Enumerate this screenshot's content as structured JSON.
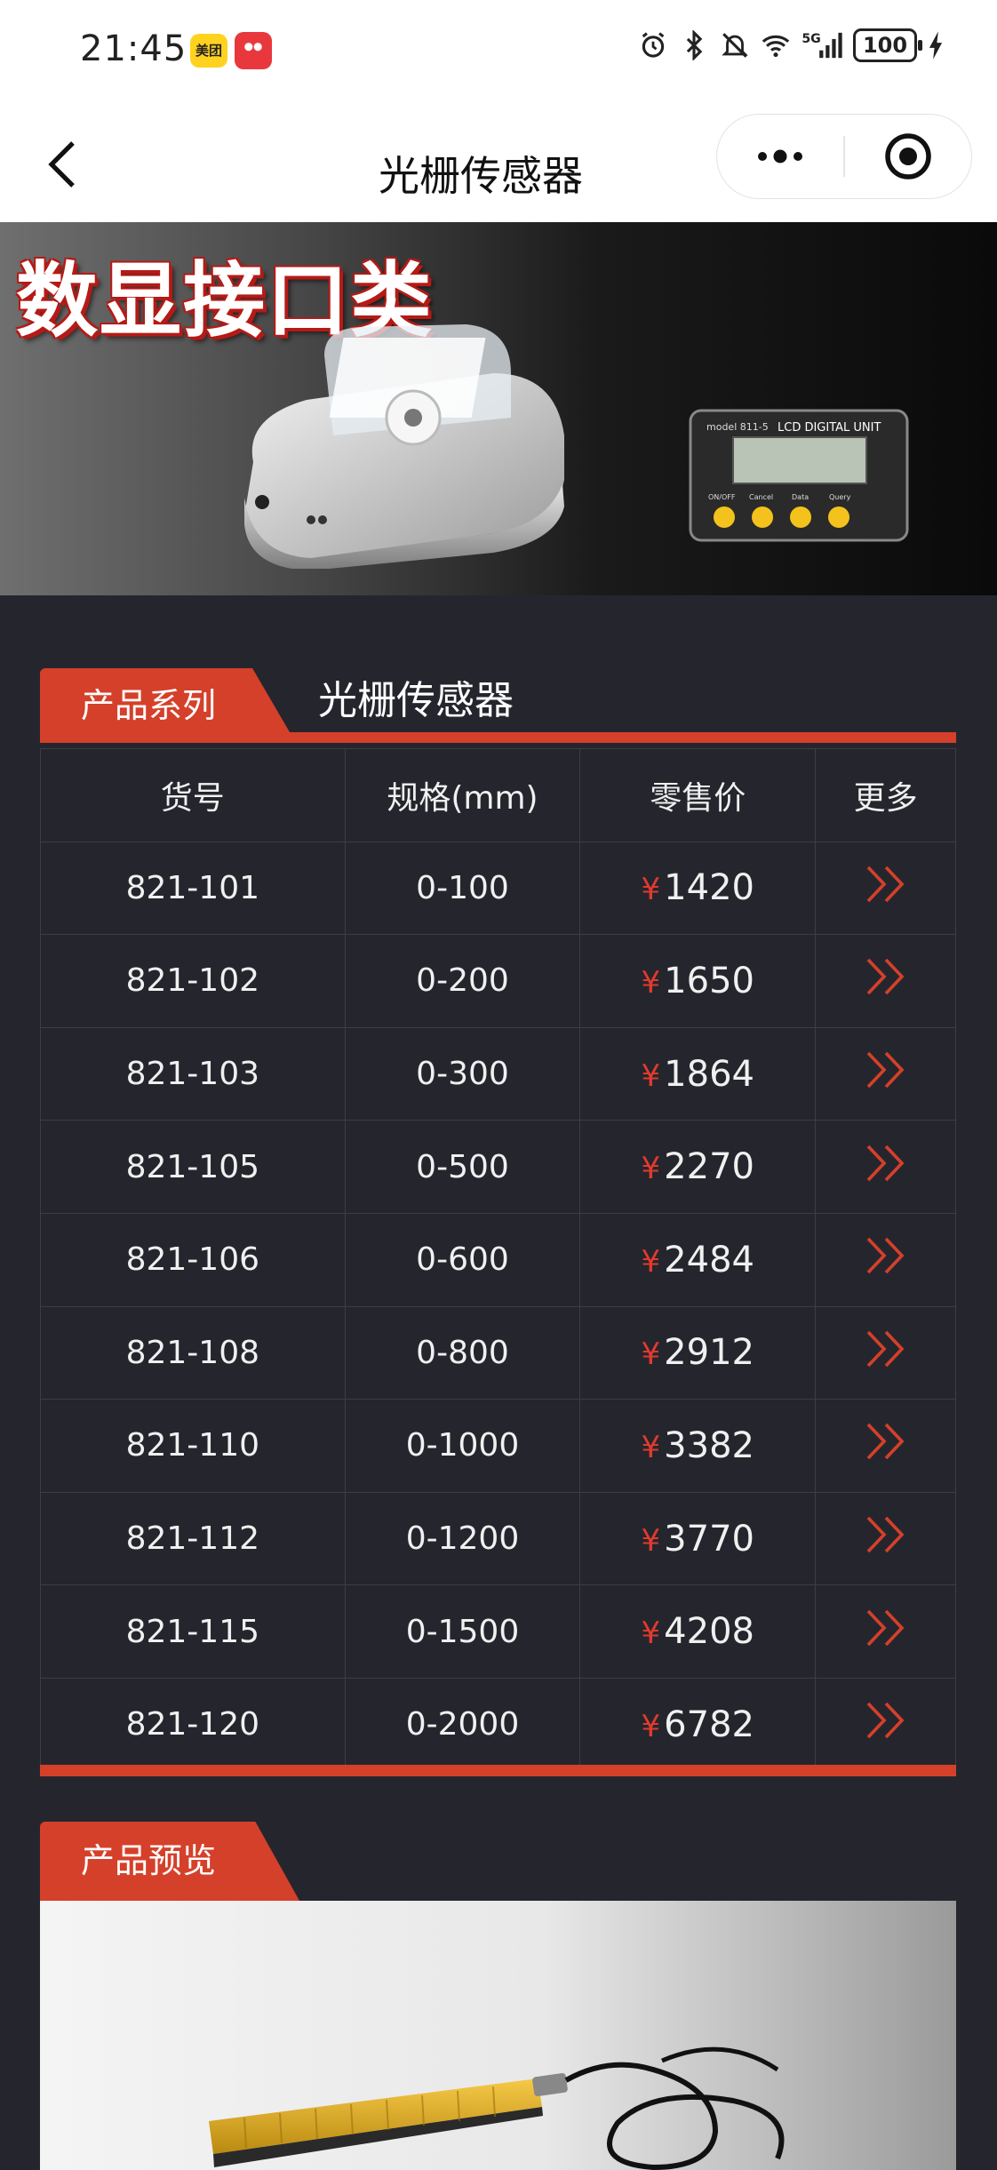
{
  "status_bar": {
    "time": "21:45",
    "app_badge_1": "美团",
    "battery": "100"
  },
  "nav": {
    "title": "光栅传感器"
  },
  "banner": {
    "title": "数显接口类",
    "device_model": "model 811-5",
    "device_label": "LCD DIGITAL UNIT",
    "device_buttons": [
      "ON/OFF",
      "Cancel",
      "Data",
      "Query"
    ]
  },
  "series_section": {
    "tab_label": "产品系列",
    "subtitle": "光栅传感器"
  },
  "table": {
    "headers": [
      "货号",
      "规格(mm)",
      "零售价",
      "更多"
    ],
    "currency": "¥",
    "rows": [
      {
        "code": "821-101",
        "spec": "0-100",
        "price": "1420"
      },
      {
        "code": "821-102",
        "spec": "0-200",
        "price": "1650"
      },
      {
        "code": "821-103",
        "spec": "0-300",
        "price": "1864"
      },
      {
        "code": "821-105",
        "spec": "0-500",
        "price": "2270"
      },
      {
        "code": "821-106",
        "spec": "0-600",
        "price": "2484"
      },
      {
        "code": "821-108",
        "spec": "0-800",
        "price": "2912"
      },
      {
        "code": "821-110",
        "spec": "0-1000",
        "price": "3382"
      },
      {
        "code": "821-112",
        "spec": "0-1200",
        "price": "3770"
      },
      {
        "code": "821-115",
        "spec": "0-1500",
        "price": "4208"
      },
      {
        "code": "821-120",
        "spec": "0-2000",
        "price": "6782"
      }
    ]
  },
  "preview_section": {
    "tab_label": "产品预览"
  },
  "colors": {
    "accent": "#d5402a",
    "page_bg": "#25262d",
    "price_symbol": "#e33a2e"
  }
}
